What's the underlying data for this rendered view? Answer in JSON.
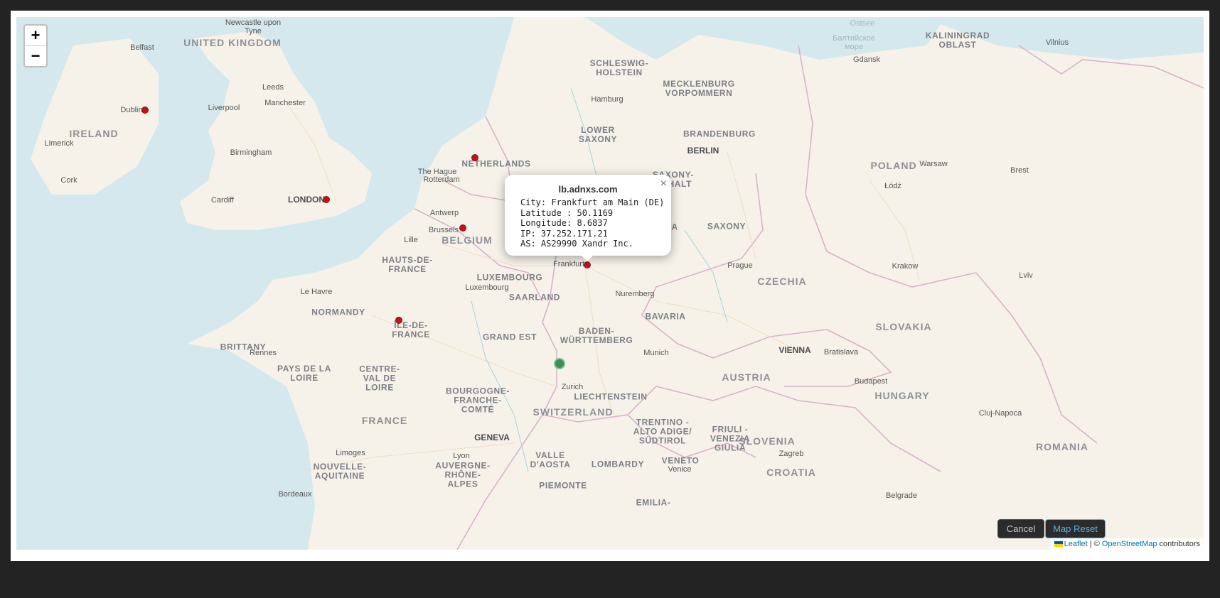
{
  "map": {
    "zoom_in": "+",
    "zoom_out": "−",
    "labels": {
      "uk": "UNITED KINGDOM",
      "ireland": "IRELAND",
      "newcastle": "Newcastle upon\nTyne",
      "belfast": "Belfast",
      "dublin": "Dublin",
      "leeds": "Leeds",
      "liverpool": "Liverpool",
      "manchester": "Manchester",
      "birmingham": "Birmingham",
      "limerick": "Limerick",
      "cork": "Cork",
      "cardiff": "Cardiff",
      "london": "LONDON",
      "netherlands": "NETHERLANDS",
      "the_hague": "The Hague",
      "rotterdam": "Rotterdam",
      "antwerp": "Antwerp",
      "brussels": "Brussels",
      "belgium": "BELGIUM",
      "lille": "Lille",
      "hauts_de_france": "HAUTS-DE-\nFRANCE",
      "luxembourg_r": "LUXEMBOURG",
      "luxembourg_c": "Luxembourg",
      "saarland": "SAARLAND",
      "le_havre": "Le Havre",
      "normandy": "NORMANDY",
      "ile_de_france": "ÎLE-DE-\nFRANCE",
      "brittany": "BRITTANY",
      "rennes": "Rennes",
      "pays_de_la_loire": "PAYS DE LA\nLOIRE",
      "centre": "CENTRE-\nVAL DE\nLOIRE",
      "grand_est": "GRAND EST",
      "bourgogne": "BOURGOGNE-\nFRANCHE-\nCOMTÉ",
      "france": "FRANCE",
      "geneva": "GENEVA",
      "limoges": "Limoges",
      "lyon": "Lyon",
      "nouvelle_aquitaine": "NOUVELLE-\nAQUITAINE",
      "auvergne": "AUVERGNE-\nRHÔNE-\nALPES",
      "bordeaux": "Bordeaux",
      "valle": "VALLE\nD'AOSTA",
      "piemonte": "PIEMONTE",
      "lombardy": "LOMBARDY",
      "emilia": "EMILIA-",
      "switzerland": "SWITZERLAND",
      "zurich": "Zurich",
      "liechtenstein": "LIECHTENSTEIN",
      "baden": "BADEN-\nWÜRTTEMBERG",
      "bavaria": "BAVARIA",
      "nuremberg": "Nuremberg",
      "munich": "Munich",
      "frankfurt": "Frankfurt",
      "schleswig": "SCHLESWIG-\nHOLSTEIN",
      "hamburg": "Hamburg",
      "mecklenburg": "MECKLENBURG\nVORPOMMERN",
      "lower_saxony": "LOWER\nSAXONY",
      "brandenburg": "BRANDENBURG",
      "berlin": "BERLIN",
      "saxony_anhalt": "SAXONY-\nANHALT",
      "thuringia": "IA",
      "saxony": "SAXONY",
      "prague": "Prague",
      "czechia": "CZECHIA",
      "trentino": "TRENTINO -\nALTO ADIGE/\nSÜDTIROL",
      "friuli": "FRIULI -\nVENEZIA\nGIULIA",
      "veneto": "VENETO",
      "venice": "Venice",
      "austria": "AUSTRIA",
      "vienna": "VIENNA",
      "bratislava": "Bratislava",
      "slovakia": "SLOVAKIA",
      "budapest": "Budapest",
      "hungary": "HUNGARY",
      "slovenia": "SLOVENIA",
      "zagreb": "Zagreb",
      "croatia": "CROATIA",
      "poland": "POLAND",
      "warsaw": "Warsaw",
      "lodz": "Łódź",
      "brest": "Brest",
      "krakow": "Krakow",
      "lviv": "Lviv",
      "gdansk": "Gdansk",
      "kaliningrad": "KALININGRAD\nOBLAST",
      "vilnius": "Vilnius",
      "ostsee": "Ostsee",
      "baltic": "Балтийское\nморе",
      "cluj": "Cluj-Napoca",
      "romania": "ROMANIA",
      "belgrade": "Belgrade"
    }
  },
  "popup": {
    "title": "lb.adnxs.com",
    "close": "×",
    "lines": [
      "City: Frankfurt am Main (DE)",
      "Latitude : 50.1169",
      "Longitude: 8.6837",
      "IP: 37.252.171.21",
      "AS: AS29990 Xandr Inc."
    ]
  },
  "attribution": {
    "leaflet": "Leaflet",
    "sep": " | © ",
    "osm": "OpenStreetMap",
    "contributors": " contributors"
  },
  "footer": {
    "cancel": "Cancel",
    "map_reset": "Map Reset"
  },
  "colors": {
    "marker": "#c0141b",
    "current_location": "#3c8f58",
    "accent": "#5ab0e0"
  }
}
